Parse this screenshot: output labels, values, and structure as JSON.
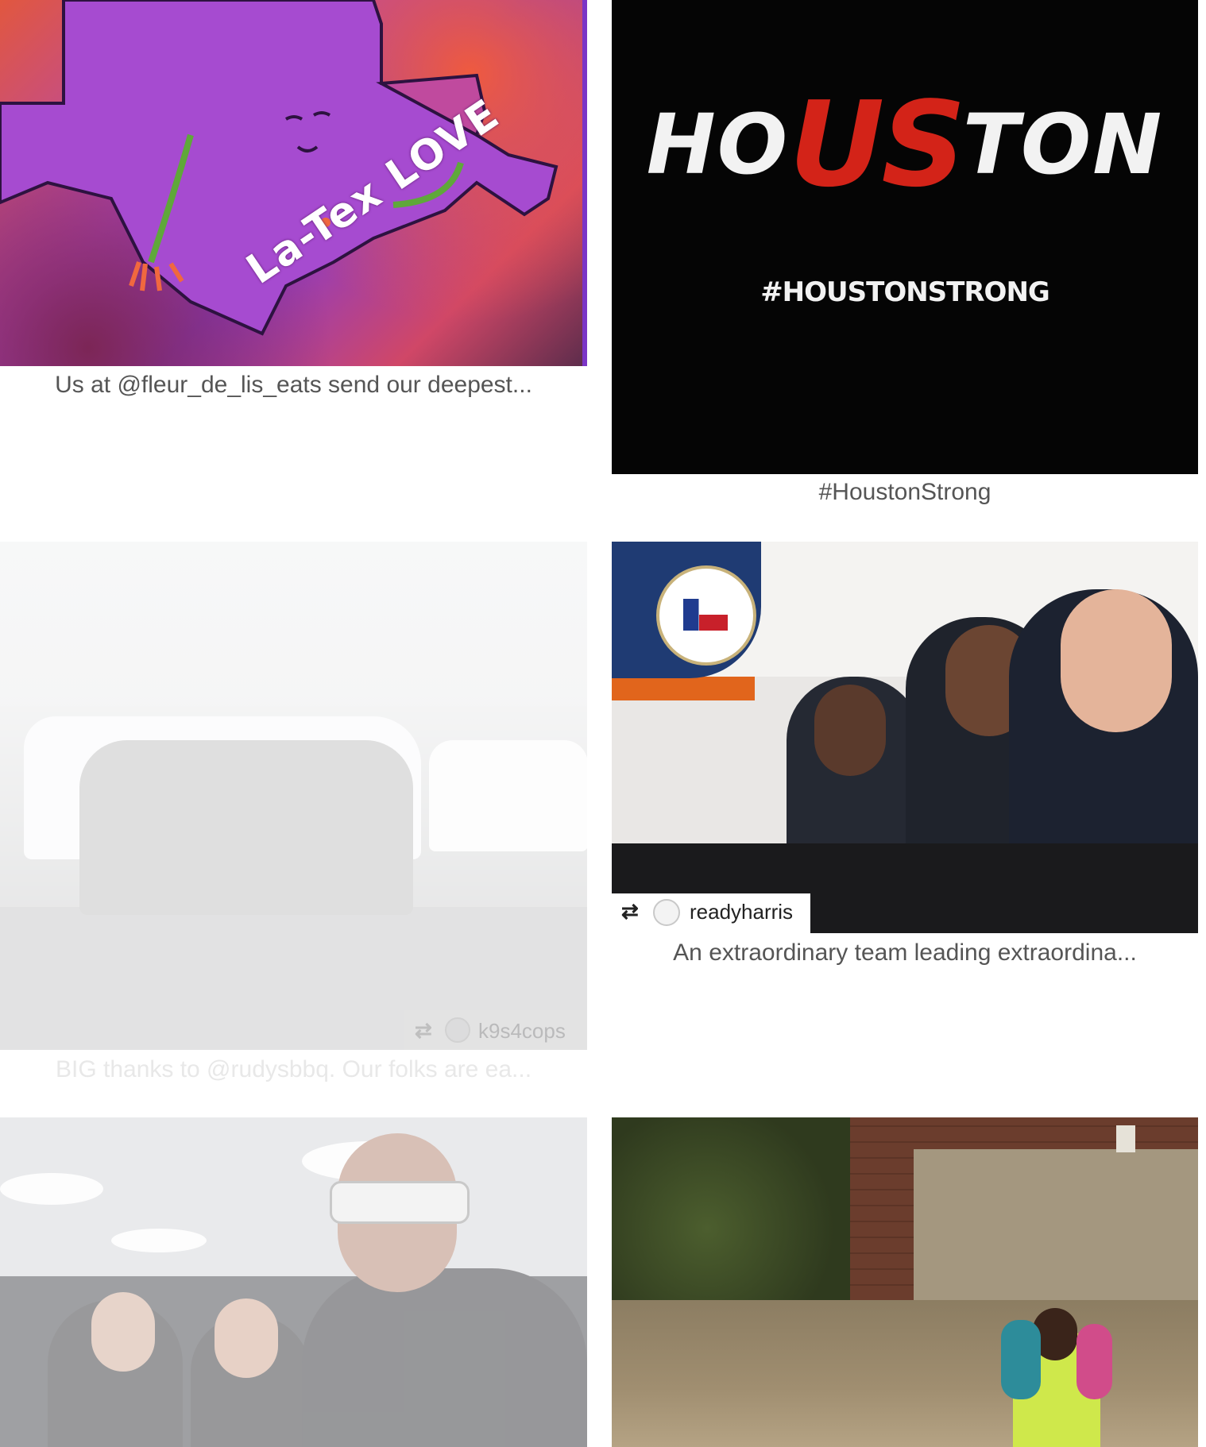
{
  "posts": [
    {
      "image_text": "La-Tex LOVE",
      "caption": "Us at @fleur_de_lis_eats send our deepest..."
    },
    {
      "image_text_left": "HO",
      "image_text_mid": "US",
      "image_text_right": "TON",
      "image_hashtag": "#HOUSTONSTRONG",
      "caption": "#HoustonStrong"
    },
    {
      "repost_user": "k9s4cops",
      "caption": "BIG thanks to @rudysbbq. Our folks are ea..."
    },
    {
      "repost_user": "readyharris",
      "caption": "An extraordinary team leading extraordina..."
    },
    {},
    {}
  ],
  "icons": {
    "repost": "repost-icon"
  },
  "colors": {
    "caption_text": "#555555",
    "houston_red": "#d32318",
    "badge_blue": "#1f3b73"
  }
}
